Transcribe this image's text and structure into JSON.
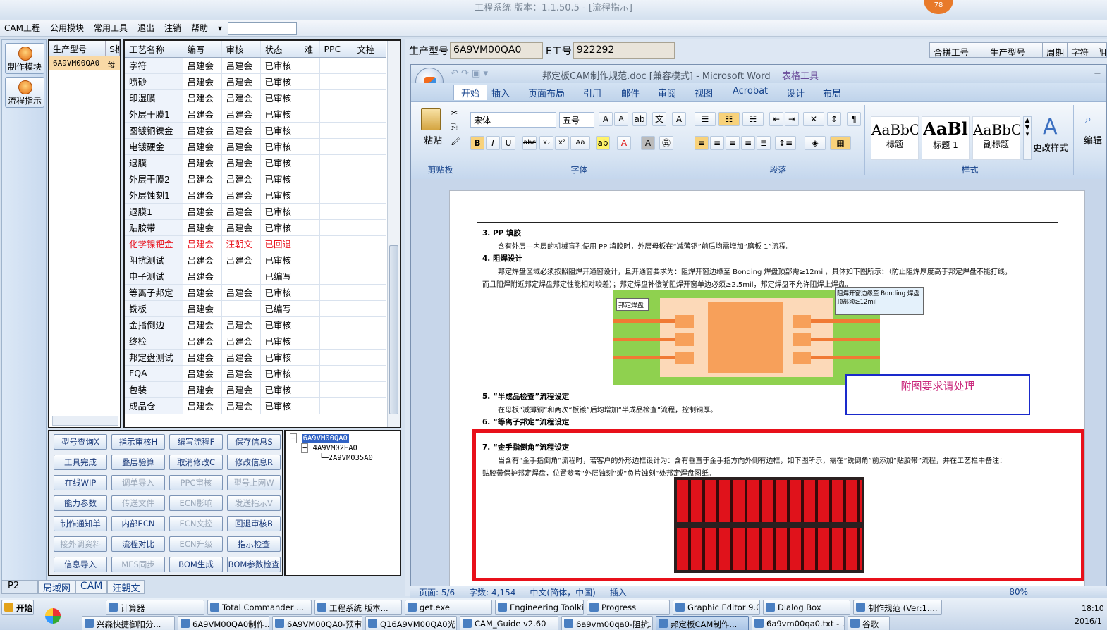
{
  "app": {
    "title": "工程系统   版本：1.1.50.5 - [流程指示]",
    "badge": "78"
  },
  "menu": [
    "CAM工程",
    "公用模块",
    "常用工具",
    "退出",
    "注销",
    "帮助"
  ],
  "sidebar": {
    "btn1": "制作模块",
    "btn2": "流程指示"
  },
  "prod": {
    "headers": [
      "生产型号",
      "S板"
    ],
    "rows": [
      [
        "6A9VM00QA0",
        "母"
      ]
    ]
  },
  "proc": {
    "headers": [
      "工艺名称",
      "编写",
      "审核",
      "状态",
      "难",
      "PPC",
      "文控"
    ],
    "rows": [
      [
        "字符",
        "吕建会",
        "吕建会",
        "已审核"
      ],
      [
        "喷砂",
        "吕建会",
        "吕建会",
        "已审核"
      ],
      [
        "印湿膜",
        "吕建会",
        "吕建会",
        "已审核"
      ],
      [
        "外层干膜1",
        "吕建会",
        "吕建会",
        "已审核"
      ],
      [
        "图镀铜镍金",
        "吕建会",
        "吕建会",
        "已审核"
      ],
      [
        "电镀硬金",
        "吕建会",
        "吕建会",
        "已审核"
      ],
      [
        "退膜",
        "吕建会",
        "吕建会",
        "已审核"
      ],
      [
        "外层干膜2",
        "吕建会",
        "吕建会",
        "已审核"
      ],
      [
        "外层蚀刻1",
        "吕建会",
        "吕建会",
        "已审核"
      ],
      [
        "退膜1",
        "吕建会",
        "吕建会",
        "已审核"
      ],
      [
        "贴胶带",
        "吕建会",
        "吕建会",
        "已审核"
      ],
      [
        "化学镍钯金",
        "吕建会",
        "汪朝文",
        "已回退"
      ],
      [
        "阻抗测试",
        "吕建会",
        "吕建会",
        "已审核"
      ],
      [
        "电子测试",
        "吕建会",
        "",
        "已编写"
      ],
      [
        "等离子邦定",
        "吕建会",
        "吕建会",
        "已审核"
      ],
      [
        "铣板",
        "吕建会",
        "",
        "已编写"
      ],
      [
        "金指倒边",
        "吕建会",
        "吕建会",
        "已审核"
      ],
      [
        "终检",
        "吕建会",
        "吕建会",
        "已审核"
      ],
      [
        "邦定盘测试",
        "吕建会",
        "吕建会",
        "已审核"
      ],
      [
        "FQA",
        "吕建会",
        "吕建会",
        "已审核"
      ],
      [
        "包装",
        "吕建会",
        "吕建会",
        "已审核"
      ],
      [
        "成品仓",
        "吕建会",
        "吕建会",
        "已审核"
      ]
    ]
  },
  "buttons": [
    [
      "型号查询X",
      "指示审核H",
      "编写流程F",
      "保存信息S"
    ],
    [
      "工具完成",
      "叠层验算",
      "取消修改C",
      "修改信息R"
    ],
    [
      "在线WIP",
      "调单导入",
      "PPC审核",
      "型号上网W"
    ],
    [
      "能力参数",
      "传送文件",
      "ECN影响",
      "发送指示V"
    ],
    [
      "制作通知单",
      "内部ECN",
      "ECN文控",
      "回退审核B"
    ],
    [
      "接外调资料",
      "流程对比",
      "ECN升级",
      "指示检查"
    ],
    [
      "信息导入",
      "MES同步",
      "BOM生成",
      "BOM参数检查"
    ]
  ],
  "disabled": [
    [
      2,
      1
    ],
    [
      2,
      2
    ],
    [
      2,
      3
    ],
    [
      3,
      1
    ],
    [
      3,
      2
    ],
    [
      3,
      3
    ],
    [
      4,
      2
    ],
    [
      5,
      0
    ],
    [
      5,
      2
    ],
    [
      6,
      1
    ]
  ],
  "tree": [
    "6A9VM00QA0",
    "4A9VM02EA0",
    "2A9VM035A0"
  ],
  "bottom": {
    "p2": "P2",
    "t1": "局域网",
    "t2": "CAM",
    "t3": "汪朝文"
  },
  "fields": {
    "l1": "生产型号",
    "v1": "6A9VM00QA0",
    "l2": "E工号",
    "v2": "922292"
  },
  "hj": [
    "合拼工号",
    "生产型号",
    "周期",
    "字符",
    "阻"
  ],
  "word": {
    "title": "邦定板CAM制作规范.doc [兼容模式] - Microsoft Word",
    "tabtools": "表格工具",
    "tabs": [
      "开始",
      "插入",
      "页面布局",
      "引用",
      "邮件",
      "审阅",
      "视图",
      "Acrobat",
      "设计",
      "布局"
    ],
    "groups": [
      "剪贴板",
      "字体",
      "段落",
      "样式"
    ],
    "paste": "粘贴",
    "font": "宋体",
    "size": "五号",
    "styles": [
      [
        "AaBbC",
        "标题"
      ],
      [
        "AaBl",
        "标题 1"
      ],
      [
        "AaBbC",
        "副标题"
      ]
    ],
    "changestyle": "更改样式",
    "edit": "编辑"
  },
  "doc": {
    "h3": "3.  PP 填胶",
    "p3": "含有外层—内层的机械盲孔使用 PP 填胶时，外层母板在“减薄铜”前后均需增加“磨板 1”流程。",
    "h4": "4.  阻焊设计",
    "p4a": "邦定焊盘区域必须按照阻焊开通窗设计，且开通窗要求为：阻焊开窗边缘至 Bonding 焊盘顶部需≥12mil，具体如下图所示：（防止阻焊厚度高于邦定焊盘不能打线，",
    "p4b": "而且阻焊附近邦定焊盘邦定性能相对较差）；邦定焊盘补偿前阻焊开窗单边必须≥2.5mil，邦定焊盘不允许阻焊上焊盘。",
    "lblpad": "邦定焊盘",
    "lblnote": "阻焊开窗边缘至 Bonding 焊盘顶部须≥12mil",
    "annot": "附图要求请处理",
    "h5": "5. “半成品检查”流程设定",
    "p5": "在母板“减薄铜”和两次“板镀”后均增加“半成品检查”流程，控制铜厚。",
    "h6": "6.  “等离子邦定”流程设定",
    "h7": "7.  “金手指倒角”流程设定",
    "p7a": "当含有“金手指倒角”流程时，若客户的外形边框设计为：含有垂直于金手指方向外侧有边框，如下图所示，需在“铣倒角”前添加“贴胶带”流程，并在工艺栏中备注：",
    "p7b": "贴胶带保护邦定焊盘，位置参考“外层蚀刻”或“负片蚀刻”处邦定焊盘图纸。"
  },
  "status": [
    "页面: 5/6",
    "字数: 4,154",
    "中文(简体，中国)",
    "插入",
    "80%"
  ],
  "taskbar": {
    "start": "开始",
    "row1": [
      "计算器",
      "Total Commander ...",
      "工程系统  版本...",
      "get.exe",
      "Engineering Toolki...",
      "Progress",
      "Graphic Editor 9.0...",
      "Dialog Box",
      "制作规范 (Ver:1...."
    ],
    "row2": [
      "兴森快捷御阳分...",
      "6A9VM00QA0制作...",
      "6A9VM00QA0-预审...",
      "Q16A9VM00QA0光...",
      "CAM_Guide v2.60",
      "6a9vm00qa0-阻抗...",
      "邦定板CAM制作...",
      "6a9vm00qa0.txt - ...",
      "谷歌"
    ],
    "time": "18:10",
    "date": "2016/1"
  },
  "colors": {
    "accent": "#15428b",
    "red": "#e8101a",
    "blue": "#1a2acb",
    "green": "#8fd14f",
    "pad": "#f7a05a"
  }
}
